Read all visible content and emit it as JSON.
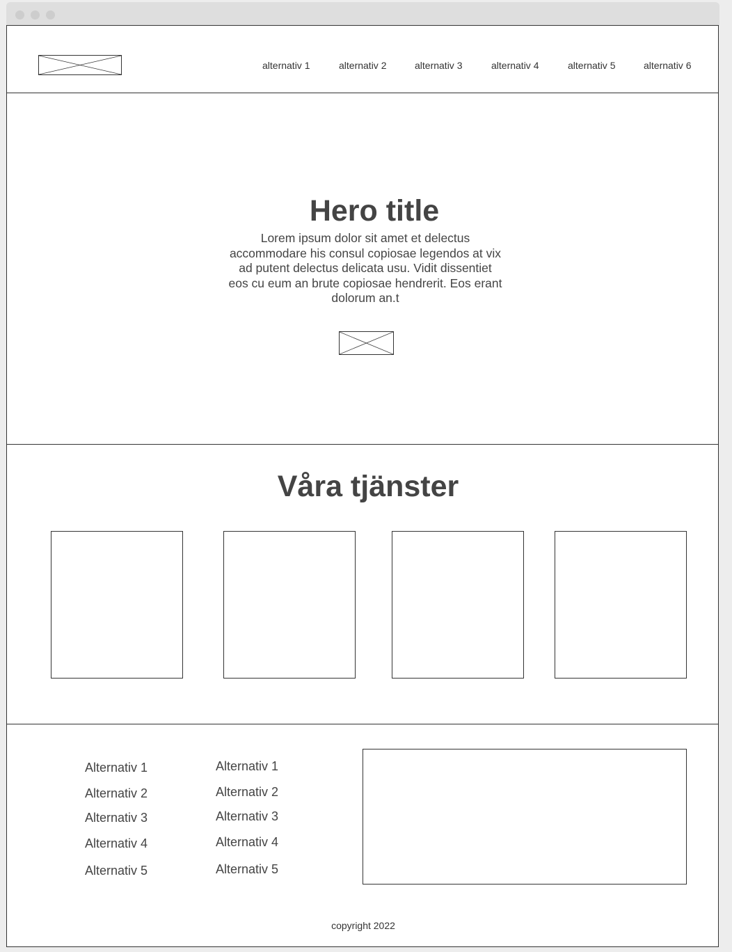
{
  "nav": {
    "items": [
      "alternativ 1",
      "alternativ 2",
      "alternativ 3",
      "alternativ 4",
      "alternativ 5",
      "alternativ 6"
    ]
  },
  "hero": {
    "title": "Hero title",
    "text": "Lorem ipsum dolor sit amet et delectus accommodare his consul copiosae legendos at vix ad putent delectus delicata usu. Vidit dissentiet eos cu eum an brute copiosae hendrerit. Eos erant dolorum an.t"
  },
  "services": {
    "title": "Våra tjänster"
  },
  "footer": {
    "col1": [
      "Alternativ 1",
      "Alternativ 2",
      "Alternativ 3",
      "Alternativ 4",
      "Alternativ 5"
    ],
    "col2": [
      "Alternativ 1",
      "Alternativ 2",
      "Alternativ 3",
      "Alternativ 4",
      "Alternativ 5"
    ],
    "copyright": "copyright 2022"
  }
}
